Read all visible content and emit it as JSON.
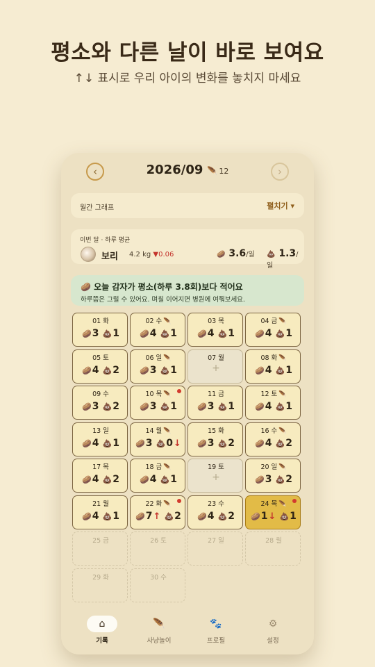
{
  "hero": {
    "title": "평소와 다른 날이 바로 보여요",
    "subtitle": "↑↓ 표시로 우리 아이의 변화를 놓치지 마세요"
  },
  "calendar": {
    "month": "2026/09",
    "feather_icon": "feather-icon",
    "feather_count": "12",
    "prev_icon": "chevron-left-icon",
    "next_icon": "chevron-right-icon"
  },
  "graph": {
    "label": "월간 그래프",
    "toggle": "펼치기 ▾"
  },
  "average": {
    "title": "이번 달 · 하루 평균",
    "pet_name": "보리",
    "weight": "4.2 kg",
    "weight_delta": "▼0.06",
    "potato_avg": "3.6",
    "potato_unit": "/일",
    "poop_avg": "1.3",
    "poop_unit": "/일"
  },
  "alert": {
    "title": "🥔 오늘 감자가 평소(하루 3.8회)보다 적어요",
    "message": "하루쯤은 그럴 수 있어요. 며칠 이어지면 병원에 여쭤보세요."
  },
  "icons": {
    "potato": "🥔",
    "poop": "💩",
    "leaf": "🪶",
    "plus": "+"
  },
  "days": [
    {
      "date": "01 화",
      "potato": "3",
      "poop": "1",
      "feather": false,
      "dot": false,
      "state": "filled",
      "up": "",
      "down": ""
    },
    {
      "date": "02 수",
      "potato": "4",
      "poop": "1",
      "feather": true,
      "dot": false,
      "state": "filled",
      "up": "",
      "down": ""
    },
    {
      "date": "03 목",
      "potato": "4",
      "poop": "1",
      "feather": false,
      "dot": false,
      "state": "filled",
      "up": "",
      "down": ""
    },
    {
      "date": "04 금",
      "potato": "4",
      "poop": "1",
      "feather": true,
      "dot": false,
      "state": "filled",
      "up": "",
      "down": ""
    },
    {
      "date": "05 토",
      "potato": "4",
      "poop": "2",
      "feather": false,
      "dot": false,
      "state": "filled",
      "up": "",
      "down": ""
    },
    {
      "date": "06 일",
      "potato": "3",
      "poop": "1",
      "feather": true,
      "dot": false,
      "state": "filled",
      "up": "",
      "down": ""
    },
    {
      "date": "07 월",
      "potato": "",
      "poop": "",
      "feather": false,
      "dot": false,
      "state": "empty",
      "up": "",
      "down": ""
    },
    {
      "date": "08 화",
      "potato": "4",
      "poop": "1",
      "feather": true,
      "dot": false,
      "state": "filled",
      "up": "",
      "down": ""
    },
    {
      "date": "09 수",
      "potato": "3",
      "poop": "2",
      "feather": false,
      "dot": false,
      "state": "filled",
      "up": "",
      "down": ""
    },
    {
      "date": "10 목",
      "potato": "3",
      "poop": "1",
      "feather": true,
      "dot": true,
      "state": "filled",
      "up": "",
      "down": ""
    },
    {
      "date": "11 금",
      "potato": "3",
      "poop": "1",
      "feather": false,
      "dot": false,
      "state": "filled",
      "up": "",
      "down": ""
    },
    {
      "date": "12 토",
      "potato": "4",
      "poop": "1",
      "feather": true,
      "dot": false,
      "state": "filled",
      "up": "",
      "down": ""
    },
    {
      "date": "13 일",
      "potato": "4",
      "poop": "1",
      "feather": false,
      "dot": false,
      "state": "filled",
      "up": "",
      "down": ""
    },
    {
      "date": "14 월",
      "potato": "3",
      "poop": "0",
      "feather": true,
      "dot": false,
      "state": "filled",
      "up": "",
      "down": "poop"
    },
    {
      "date": "15 화",
      "potato": "3",
      "poop": "2",
      "feather": false,
      "dot": false,
      "state": "filled",
      "up": "",
      "down": ""
    },
    {
      "date": "16 수",
      "potato": "4",
      "poop": "2",
      "feather": true,
      "dot": false,
      "state": "filled",
      "up": "",
      "down": ""
    },
    {
      "date": "17 목",
      "potato": "4",
      "poop": "2",
      "feather": false,
      "dot": false,
      "state": "filled",
      "up": "",
      "down": ""
    },
    {
      "date": "18 금",
      "potato": "4",
      "poop": "1",
      "feather": true,
      "dot": false,
      "state": "filled",
      "up": "",
      "down": ""
    },
    {
      "date": "19 토",
      "potato": "",
      "poop": "",
      "feather": false,
      "dot": false,
      "state": "empty",
      "up": "",
      "down": ""
    },
    {
      "date": "20 일",
      "potato": "3",
      "poop": "2",
      "feather": true,
      "dot": false,
      "state": "filled",
      "up": "",
      "down": ""
    },
    {
      "date": "21 월",
      "potato": "4",
      "poop": "1",
      "feather": false,
      "dot": false,
      "state": "filled",
      "up": "",
      "down": ""
    },
    {
      "date": "22 화",
      "potato": "7",
      "poop": "2",
      "feather": true,
      "dot": true,
      "state": "filled",
      "up": "potato",
      "down": ""
    },
    {
      "date": "23 수",
      "potato": "4",
      "poop": "2",
      "feather": false,
      "dot": false,
      "state": "filled",
      "up": "",
      "down": ""
    },
    {
      "date": "24 목",
      "potato": "1",
      "poop": "1",
      "feather": true,
      "dot": true,
      "state": "today",
      "up": "",
      "down": "potato"
    },
    {
      "date": "25 금",
      "potato": "",
      "poop": "",
      "feather": false,
      "dot": false,
      "state": "future",
      "up": "",
      "down": ""
    },
    {
      "date": "26 토",
      "potato": "",
      "poop": "",
      "feather": false,
      "dot": false,
      "state": "future",
      "up": "",
      "down": ""
    },
    {
      "date": "27 일",
      "potato": "",
      "poop": "",
      "feather": false,
      "dot": false,
      "state": "future",
      "up": "",
      "down": ""
    },
    {
      "date": "28 월",
      "potato": "",
      "poop": "",
      "feather": false,
      "dot": false,
      "state": "future",
      "up": "",
      "down": ""
    },
    {
      "date": "29 화",
      "potato": "",
      "poop": "",
      "feather": false,
      "dot": false,
      "state": "future",
      "up": "",
      "down": ""
    },
    {
      "date": "30 수",
      "potato": "",
      "poop": "",
      "feather": false,
      "dot": false,
      "state": "future",
      "up": "",
      "down": ""
    }
  ],
  "tabs": [
    {
      "label": "기록",
      "icon": "home-icon",
      "glyph": "⌂",
      "active": true
    },
    {
      "label": "사냥놀이",
      "icon": "feather-icon",
      "glyph": "🪶",
      "active": false
    },
    {
      "label": "프로필",
      "icon": "paw-icon",
      "glyph": "🐾",
      "active": false
    },
    {
      "label": "설정",
      "icon": "gear-icon",
      "glyph": "⚙",
      "active": false
    }
  ],
  "colors": {
    "background": "#f6ecd2",
    "today": "#e2bb47",
    "alert_bg": "#d7e7ce",
    "down_red": "#c4342d"
  }
}
